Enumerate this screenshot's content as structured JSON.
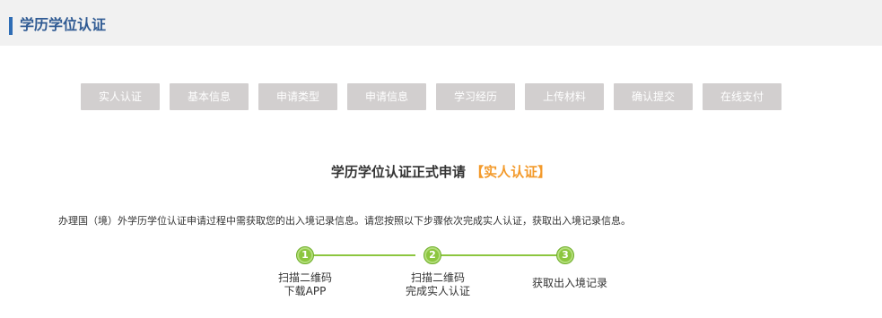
{
  "header": {
    "title": "学历学位认证"
  },
  "tabs": [
    {
      "label": "实人认证"
    },
    {
      "label": "基本信息"
    },
    {
      "label": "申请类型"
    },
    {
      "label": "申请信息"
    },
    {
      "label": "学习经历"
    },
    {
      "label": "上传材料"
    },
    {
      "label": "确认提交"
    },
    {
      "label": "在线支付"
    }
  ],
  "main": {
    "title": "学历学位认证正式申请",
    "title_highlight": "【实人认证】",
    "intro": "办理国（境）外学历学位认证申请过程中需获取您的出入境记录信息。请您按照以下步骤依次完成实人认证，获取出入境记录信息。"
  },
  "steps": [
    {
      "number": "1",
      "line1": "扫描二维码",
      "line2": "下载APP"
    },
    {
      "number": "2",
      "line1": "扫描二维码",
      "line2": "完成实人认证"
    },
    {
      "number": "3",
      "line1": "获取出入境记录",
      "line2": ""
    }
  ],
  "colors": {
    "accent_blue": "#2f6db5",
    "tab_bg": "#d2cfcf",
    "highlight_orange": "#f39a2b",
    "step_green": "#8cc63f"
  }
}
